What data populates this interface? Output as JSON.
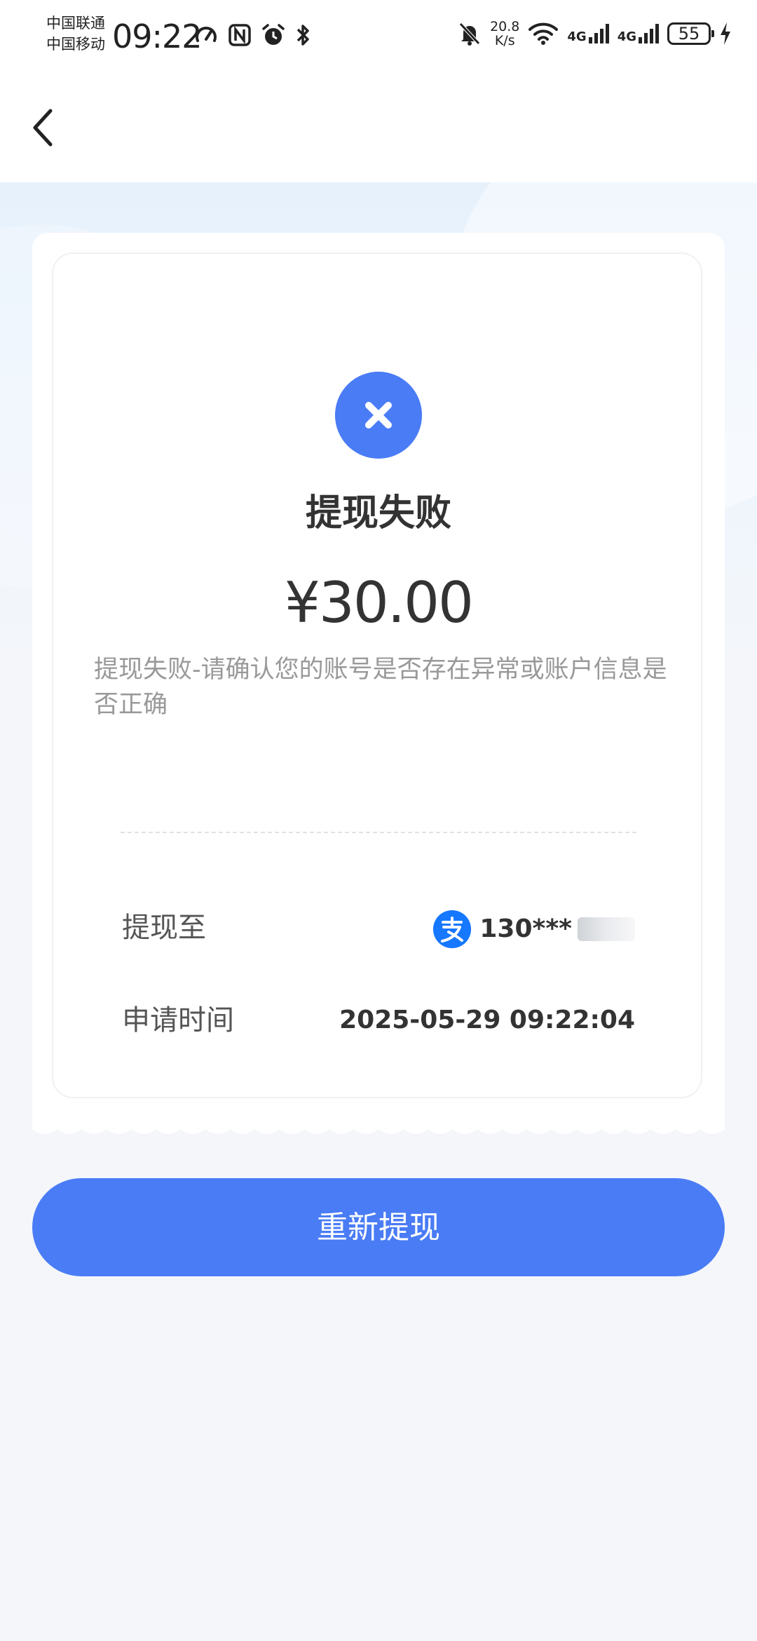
{
  "status_bar": {
    "carrier_1": "中国联通",
    "carrier_2": "中国移动",
    "time": "09:22",
    "speed_value": "20.8",
    "speed_unit": "K/s",
    "net_1": "4G",
    "net_2": "4G",
    "battery": "55"
  },
  "result": {
    "title": "提现失败",
    "amount": "¥30.00",
    "description": "提现失败-请确认您的账号是否存在异常或账户信息是否正确",
    "status_color": "#4a7cf6"
  },
  "details": {
    "withdraw_to_label": "提现至",
    "account_masked": "130***",
    "apply_time_label": "申请时间",
    "apply_time_value": "2025-05-29 09:22:04"
  },
  "retry_button": {
    "label": "重新提现"
  },
  "icons": {
    "back": "chevron-left-icon",
    "fail": "close-icon",
    "account_provider": "alipay-icon"
  }
}
